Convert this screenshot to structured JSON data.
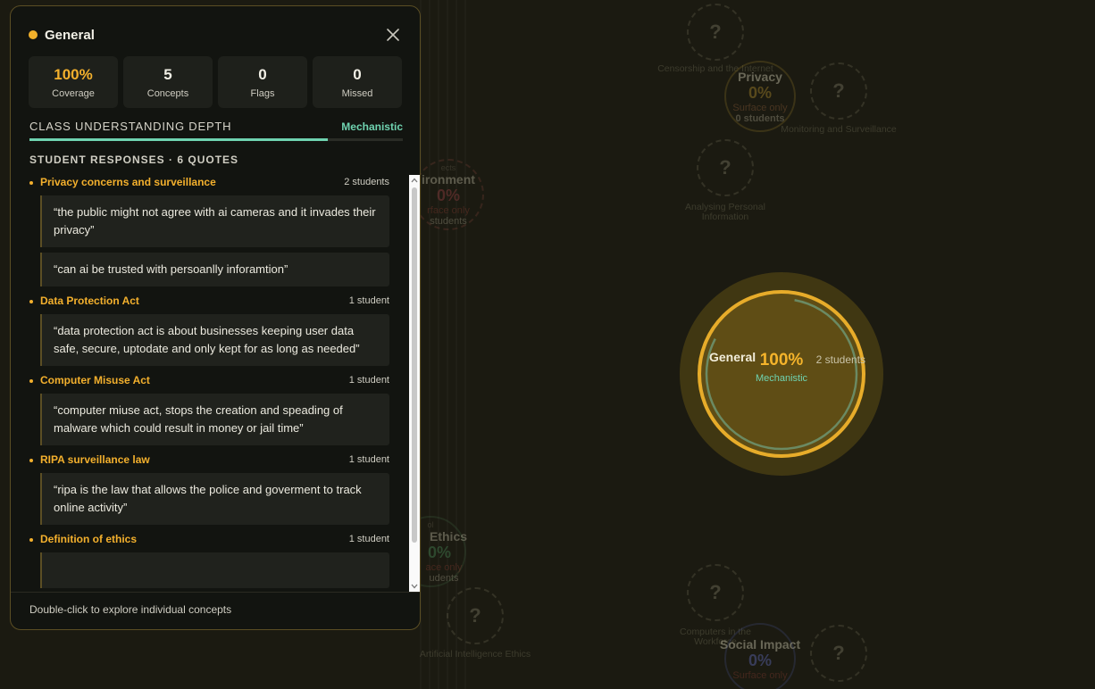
{
  "panel": {
    "title": "General",
    "stats": [
      {
        "value": "100%",
        "label": "Coverage"
      },
      {
        "value": "5",
        "label": "Concepts"
      },
      {
        "value": "0",
        "label": "Flags"
      },
      {
        "value": "0",
        "label": "Missed"
      }
    ],
    "depth": {
      "title": "CLASS UNDERSTANDING DEPTH",
      "value": "Mechanistic",
      "fill_fraction": 0.8
    },
    "responses_title": "STUDENT RESPONSES · 6 QUOTES",
    "groups": [
      {
        "name": "Privacy concerns and surveillance",
        "count": "2 students",
        "quotes": [
          "“the public might not agree with ai cameras and it invades their privacy”",
          "“can ai be trusted with persoanlly inforamtion”"
        ]
      },
      {
        "name": "Data Protection Act",
        "count": "1 student",
        "quotes": [
          "“data protection act is about businesses keeping user data safe, secure, uptodate and only kept for as long as needed”"
        ]
      },
      {
        "name": "Computer Misuse Act",
        "count": "1 student",
        "quotes": [
          "“computer miuse act, stops the creation and speading of malware which could result in money or jail time”"
        ]
      },
      {
        "name": "RIPA surveillance law",
        "count": "1 student",
        "quotes": [
          "“ripa is the law that allows the police and goverment to track online activity”"
        ]
      },
      {
        "name": "Definition of ethics",
        "count": "1 student",
        "quotes": [
          ""
        ]
      }
    ],
    "footer": "Double-click to explore individual concepts"
  },
  "map": {
    "general": {
      "name": "General",
      "pct": "100%",
      "depth": "Mechanistic",
      "count": "2 students"
    },
    "privacy": {
      "name": "Privacy",
      "pct": "0%",
      "depth": "Surface only",
      "count": "0 students"
    },
    "environment": {
      "name": "ironment",
      "pct": "0%",
      "depth": "rface only",
      "count": "students",
      "tag": "ects"
    },
    "ethics": {
      "name": "Ethics",
      "pct": "0%",
      "depth": "ace only",
      "count": "udents",
      "tag": "ol"
    },
    "social": {
      "name": "Social Impact",
      "pct": "0%",
      "depth": "Surface only"
    },
    "unknowns": [
      {
        "label": "Censorship and the Internet"
      },
      {
        "label": "Monitoring and Surveillance"
      },
      {
        "label": "Analysing Personal Information"
      },
      {
        "label": "Computers in the Workforce"
      },
      {
        "label": "Artificial Intelligence Ethics"
      },
      {
        "label": ""
      }
    ],
    "unknown_glyph": "?",
    "colors": {
      "accent": "#f3b02d",
      "mechanistic": "#6fd3b0",
      "surface": "#8a4b3a"
    }
  }
}
